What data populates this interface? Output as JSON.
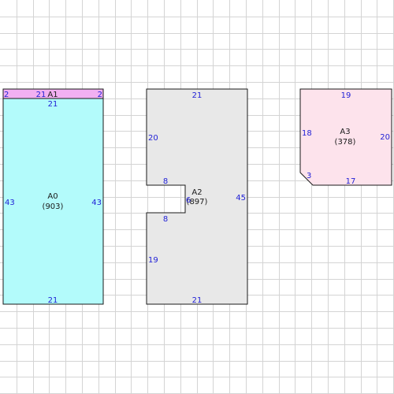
{
  "colors": {
    "background": "#ffffff",
    "grid": "#d4d4d4",
    "outline": "#1a1a1a",
    "dimension_text": "#1f1fd6",
    "label_text": "#1a1a1a"
  },
  "rooms": [
    {
      "id": "a0",
      "name": "A0",
      "area": "(903)",
      "fill": "#b3fbfb",
      "dimensions": {
        "top": "21",
        "bottom": "21",
        "left": "43",
        "right": "43"
      }
    },
    {
      "id": "a1",
      "name": "A1",
      "fill": "#f2b0f2",
      "dimensions": {
        "top": "21",
        "left": "2",
        "right": "2"
      }
    },
    {
      "id": "a2",
      "name": "A2",
      "area": "(897)",
      "fill": "#e8e8e8",
      "dimensions": {
        "top": "21",
        "bottom": "21",
        "right": "45",
        "left_upper": "20",
        "left_lower": "19",
        "notch_top": "8",
        "notch_bottom": "8",
        "notch_depth": "6"
      }
    },
    {
      "id": "a3",
      "name": "A3",
      "area": "(378)",
      "fill": "#fde3ec",
      "dimensions": {
        "top": "19",
        "bottom": "17",
        "left": "18",
        "right": "20",
        "chamfer": "3"
      }
    }
  ]
}
